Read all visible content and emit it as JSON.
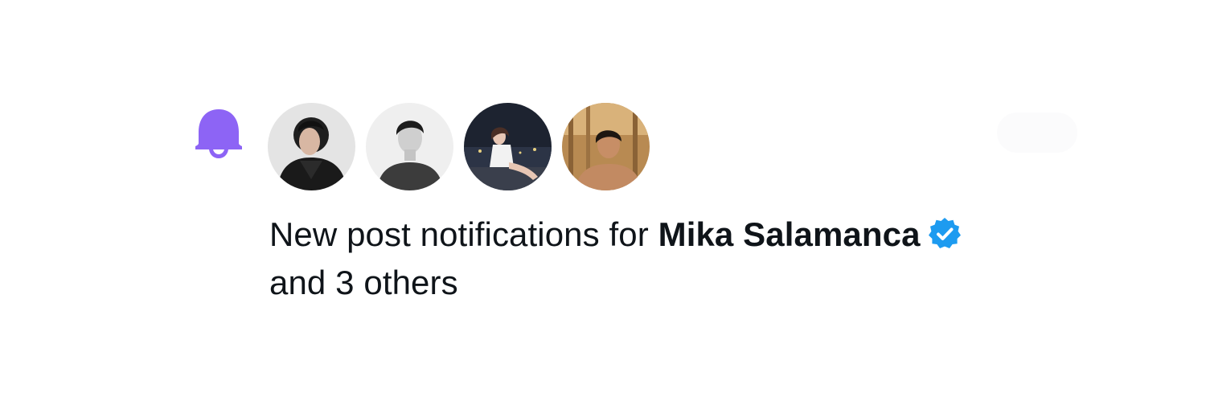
{
  "notification": {
    "text_prefix": "New post notifications for",
    "name": "Mika Salamanca",
    "text_suffix": "and 3 others",
    "icon": "bell-icon",
    "badge_icon": "verified-badge-icon",
    "accent_color": "#8d64f5",
    "verified_color": "#1d9bf0",
    "text_color": "#0f1419"
  },
  "avatars": [
    {
      "icon": "avatar-photo"
    },
    {
      "icon": "avatar-photo"
    },
    {
      "icon": "avatar-photo"
    },
    {
      "icon": "avatar-photo"
    }
  ]
}
